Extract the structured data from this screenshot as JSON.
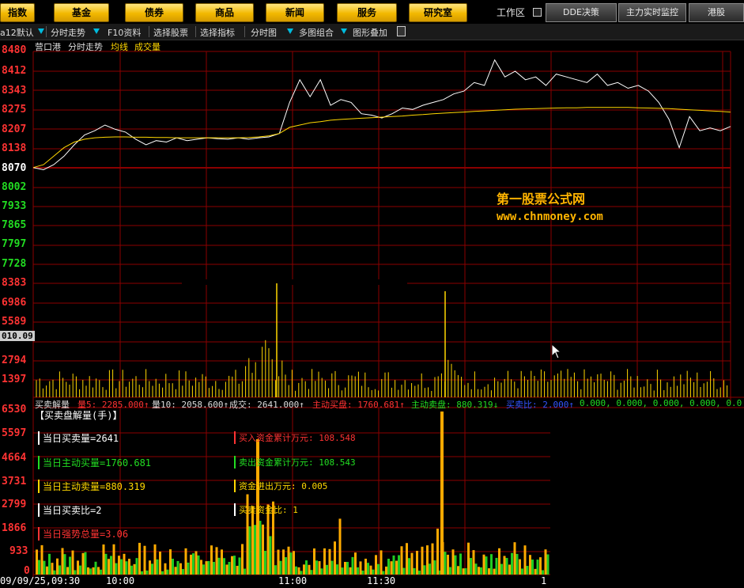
{
  "nav": {
    "buttons": [
      "指数",
      "基金",
      "债券",
      "商品",
      "新闻",
      "服务",
      "研究室"
    ],
    "workspace_label": "工作区",
    "right_buttons": [
      "DDE决策",
      "主力实时监控",
      "港股"
    ]
  },
  "toolbar": {
    "scheme": "a12默认",
    "items": [
      "分时走势",
      "F10资料",
      "选择股票",
      "选择指标",
      "分时图",
      "多图组合",
      "图形叠加"
    ]
  },
  "chart_header": {
    "stock_name": "营口港",
    "view": "分时走势",
    "avg_label": "均线",
    "vol_label": "成交量"
  },
  "price_axis": {
    "upper_labels": [
      "8480",
      "8412",
      "8343",
      "8275",
      "8207",
      "8138"
    ],
    "base_label": "8070",
    "lower_labels": [
      "8002",
      "7933",
      "7865",
      "7797",
      "7728"
    ]
  },
  "volume_axis": {
    "labels": [
      "8383",
      "6986",
      "5589",
      "010.09",
      "2794",
      "1397"
    ]
  },
  "indicator_bar": {
    "title": "买卖解量",
    "items": [
      "量5: 2285.000↑",
      "量10: 2058.600↑",
      "成交: 2641.000↑",
      "主动买盘: 1760.681↑",
      "主动卖盘: 880.319↓",
      "买卖比: 2.000↑",
      "0.000, 0.000, 0.000, 0.000, 0.0"
    ]
  },
  "lower_panel": {
    "title": "【买卖盘解量(手)】",
    "axis_labels": [
      "6530",
      "5597",
      "4664",
      "3731",
      "2799",
      "1866",
      "933",
      "0"
    ],
    "stats_left": [
      "当日买卖量=2641",
      "当日主动买量=1760.681",
      "当日主动卖量=880.319",
      "当日买卖比=2",
      "当日强势总量=3.06"
    ],
    "stats_right": [
      "买入资金累计万元: 108.548",
      "卖出资金累计万元: 108.543",
      "资金进出万元: 0.005",
      "买卖资金比: 1"
    ]
  },
  "time_axis": {
    "labels": [
      "09/09/25,09:30",
      "10:00",
      "11:00",
      "11:30",
      "1"
    ]
  },
  "watermark": {
    "name": "第一股票公式网",
    "url": "www.chnmoney.com"
  },
  "chart_data": {
    "type": "line",
    "title": "营口港 分时走势",
    "base_price": 8070,
    "ylim": [
      7728,
      8480
    ],
    "time_labels": [
      "09:30",
      "10:00",
      "11:00",
      "11:30"
    ],
    "series": [
      {
        "name": "分时",
        "color": "#ffffff",
        "values": [
          8070,
          8062,
          8080,
          8110,
          8150,
          8185,
          8200,
          8220,
          8205,
          8195,
          8170,
          8150,
          8165,
          8160,
          8175,
          8165,
          8170,
          8175,
          8172,
          8170,
          8175,
          8170,
          8175,
          8178,
          8190,
          8300,
          8380,
          8320,
          8380,
          8290,
          8310,
          8300,
          8260,
          8255,
          8245,
          8260,
          8280,
          8275,
          8290,
          8300,
          8310,
          8330,
          8340,
          8370,
          8360,
          8450,
          8390,
          8410,
          8380,
          8390,
          8360,
          8400,
          8390,
          8380,
          8370,
          8400,
          8360,
          8370,
          8350,
          8360,
          8340,
          8300,
          8240,
          8140,
          8250,
          8200,
          8210,
          8200,
          8215
        ]
      },
      {
        "name": "均线",
        "color": "#ffd700",
        "values": [
          8070,
          8080,
          8110,
          8140,
          8160,
          8170,
          8175,
          8177,
          8178,
          8178,
          8177,
          8177,
          8176,
          8176,
          8175,
          8175,
          8175,
          8175,
          8175,
          8175,
          8175,
          8176,
          8178,
          8182,
          8190,
          8212,
          8220,
          8228,
          8232,
          8237,
          8240,
          8242,
          8244,
          8246,
          8248,
          8250,
          8252,
          8255,
          8257,
          8260,
          8262,
          8264,
          8266,
          8268,
          8270,
          8272,
          8274,
          8276,
          8277,
          8278,
          8279,
          8280,
          8281,
          8281,
          8282,
          8282,
          8282,
          8282,
          8282,
          8281,
          8280,
          8279,
          8278,
          8276,
          8274,
          8272,
          8270,
          8268,
          8266
        ]
      }
    ]
  }
}
